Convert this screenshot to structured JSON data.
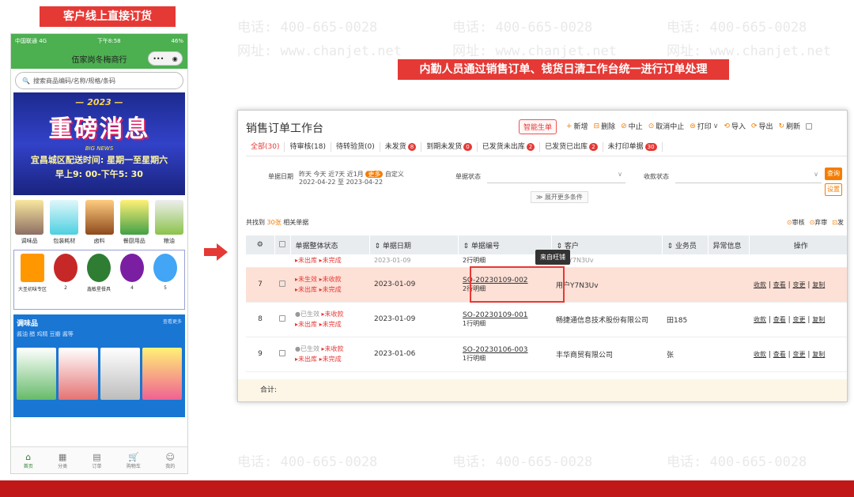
{
  "watermark": {
    "phone": "电话: 400-665-0028",
    "site": "网址: www.chanjet.net"
  },
  "labels": {
    "customer": "客户线上直接订货",
    "staff": "内勤人员通过销售订单、钱货日清工作台统一进行订单处理"
  },
  "phone": {
    "carrier": "中国联通 4G",
    "time": "下午8:58",
    "battery": "46%",
    "shop_name": "伍家岗冬梅商行",
    "search_placeholder": "搜索商品编码/名称/规格/条码",
    "promo": {
      "year": "— 2023 —",
      "headline": "重磅消息",
      "news": "BIG NEWS",
      "line1": "宜昌城区配送时间: 星期一至星期六",
      "line2": "早上9: 00-下午5: 30"
    },
    "categories": [
      "调味品",
      "包装耗材",
      "卤料",
      "餐厨用品",
      "粮油"
    ],
    "row2": [
      "大圣初味专区",
      "2",
      "鑫敏星餐具",
      "4",
      "5"
    ],
    "section": {
      "title": "调味品",
      "subtitle": "酱油 醋 鸡精 豆瓣 酱等",
      "more": "查看更多"
    },
    "tabs": [
      "首页",
      "分类",
      "订单",
      "购物车",
      "我的"
    ]
  },
  "window": {
    "title": "销售订单工作台",
    "smart_button": "智能生单",
    "toolbar": [
      "新增",
      "删除",
      "中止",
      "取消中止",
      "打印",
      "导入",
      "导出",
      "刷新"
    ],
    "tabs": [
      {
        "label": "全部(30)",
        "active": true,
        "badge": ""
      },
      {
        "label": "待审核(18)",
        "badge": ""
      },
      {
        "label": "待转验货(0)",
        "badge": ""
      },
      {
        "label": "未发货",
        "badge": "8"
      },
      {
        "label": "到期未发货",
        "badge": "0"
      },
      {
        "label": "已发货未出库",
        "badge": "2"
      },
      {
        "label": "已发货已出库",
        "badge": "2"
      },
      {
        "label": "未打印单据",
        "badge": "30"
      }
    ],
    "filter": {
      "date_label": "单据日期",
      "date_quick": "昨天  今天  近7天  近1月",
      "more": "更多",
      "custom": "自定义",
      "date_range": "2022-04-22 至 2023-04-22",
      "status_label": "单据状态",
      "receipt_label": "收款状态",
      "query": "查询",
      "settings": "设置",
      "expand": "展开更多条件"
    },
    "count_prefix": "共找到 ",
    "count_value": "30张",
    "count_suffix": " 相关单据",
    "count_actions": [
      "审核",
      "弃审",
      "发"
    ],
    "columns": [
      "单据整体状态",
      "单据日期",
      "单据编号",
      "客户",
      "业务员",
      "异常信息",
      "操作"
    ],
    "partial_row": {
      "date": "2023-01-09",
      "detail": "2行明细",
      "customer": "用户Y7N3Uv"
    },
    "rows": [
      {
        "idx": "7",
        "status1": "未生效",
        "status2": "未收款",
        "status3": "未出库",
        "status4": "未完成",
        "date": "2023-01-09",
        "no": "SO-20230109-002",
        "detail": "2行明细",
        "customer": "用户Y7N3Uv",
        "salesperson": ""
      },
      {
        "idx": "8",
        "status1": "已生效",
        "status2": "未收款",
        "status3": "未出库",
        "status4": "未完成",
        "date": "2023-01-09",
        "no": "SO-20230109-001",
        "detail": "1行明细",
        "customer": "畅捷通信息技术股份有限公司",
        "salesperson": "田185"
      },
      {
        "idx": "9",
        "status1": "已生效",
        "status2": "未收款",
        "status3": "未出库",
        "status4": "未完成",
        "date": "2023-01-06",
        "no": "SO-20230106-003",
        "detail": "1行明细",
        "customer": "丰华商贸有限公司",
        "salesperson": "张"
      }
    ],
    "ops": [
      "收款",
      "查看",
      "变更",
      "复制"
    ],
    "tooltip": "来自旺铺",
    "total": "合计:"
  }
}
